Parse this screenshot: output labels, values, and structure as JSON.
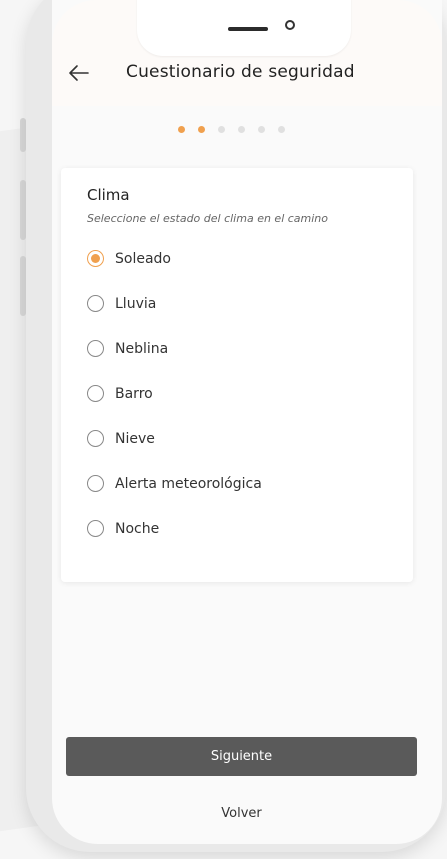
{
  "header": {
    "title": "Cuestionario de seguridad",
    "back_icon": "arrow-left-icon"
  },
  "stepper": {
    "total_steps": 6,
    "current_step": 2,
    "active_color": "#f0a04e",
    "inactive_color": "#e0e0e0"
  },
  "question": {
    "title": "Clima",
    "subtitle": "Seleccione el estado del clima en el camino",
    "selected": "Soleado",
    "options": [
      {
        "label": "Soleado",
        "checked": true
      },
      {
        "label": "Lluvia",
        "checked": false
      },
      {
        "label": "Neblina",
        "checked": false
      },
      {
        "label": "Barro",
        "checked": false
      },
      {
        "label": "Nieve",
        "checked": false
      },
      {
        "label": "Alerta meteorológica",
        "checked": false
      },
      {
        "label": "Noche",
        "checked": false
      }
    ]
  },
  "actions": {
    "next_label": "Siguiente",
    "back_label": "Volver"
  },
  "colors": {
    "accent": "#f0a04e",
    "primary_button": "#5a5a5a"
  }
}
